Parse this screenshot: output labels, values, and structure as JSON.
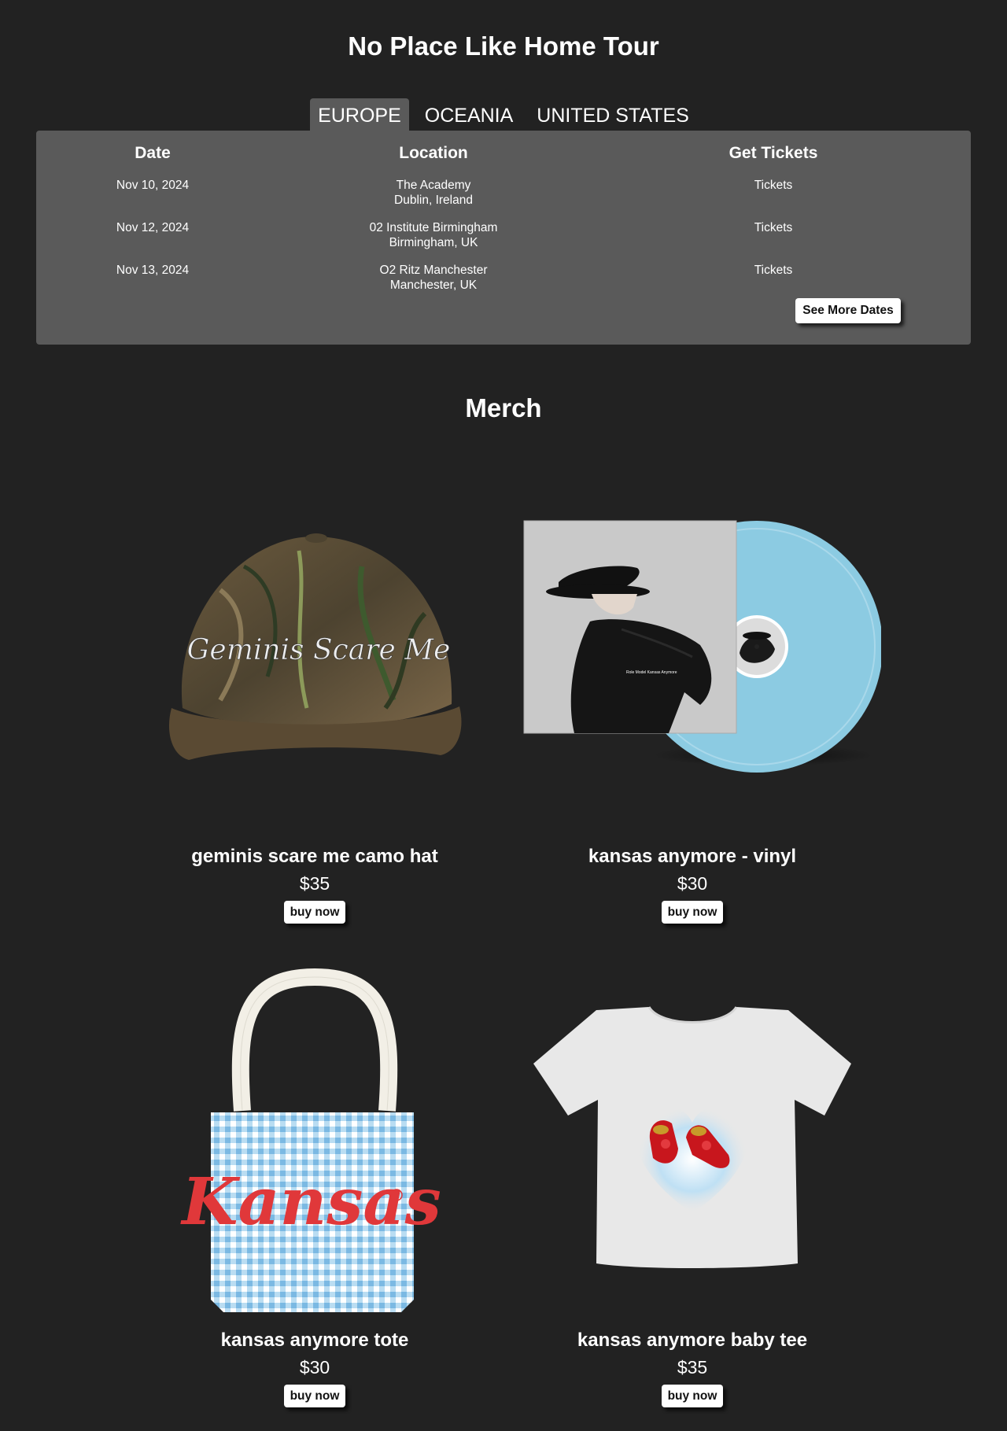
{
  "tour": {
    "title": "No Place Like Home Tour",
    "tabs": [
      "EUROPE",
      "OCEANIA",
      "UNITED STATES"
    ],
    "active_tab": "EUROPE",
    "headers": {
      "date": "Date",
      "location": "Location",
      "tickets": "Get Tickets"
    },
    "rows": [
      {
        "date": "Nov 10, 2024",
        "venue": "The Academy",
        "city": "Dublin, Ireland",
        "tickets": "Tickets"
      },
      {
        "date": "Nov 12, 2024",
        "venue": "02 Institute Birmingham",
        "city": "Birmingham, UK",
        "tickets": "Tickets"
      },
      {
        "date": "Nov 13, 2024",
        "venue": "O2 Ritz Manchester",
        "city": "Manchester, UK",
        "tickets": "Tickets"
      }
    ],
    "see_more": "See More Dates"
  },
  "merch": {
    "title": "Merch",
    "products": [
      {
        "name": "geminis scare me camo hat",
        "price": "$35",
        "buy": "buy now",
        "image": "camo-hat",
        "image_text": "Geminis Scare Me"
      },
      {
        "name": "kansas anymore - vinyl",
        "price": "$30",
        "buy": "buy now",
        "image": "vinyl-record",
        "image_text": "Role Model  Kansas Anymore"
      },
      {
        "name": "kansas anymore tote",
        "price": "$30",
        "buy": "buy now",
        "image": "gingham-tote",
        "image_text": "Kansas"
      },
      {
        "name": "kansas anymore baby tee",
        "price": "$35",
        "buy": "buy now",
        "image": "baby-tee"
      }
    ]
  },
  "colors": {
    "background": "#222222",
    "panel": "#5a5a5a",
    "button": "#ffffff",
    "vinyl": "#8ccbe2",
    "tote_red": "#e0383a",
    "slipper_red": "#c8161d"
  }
}
